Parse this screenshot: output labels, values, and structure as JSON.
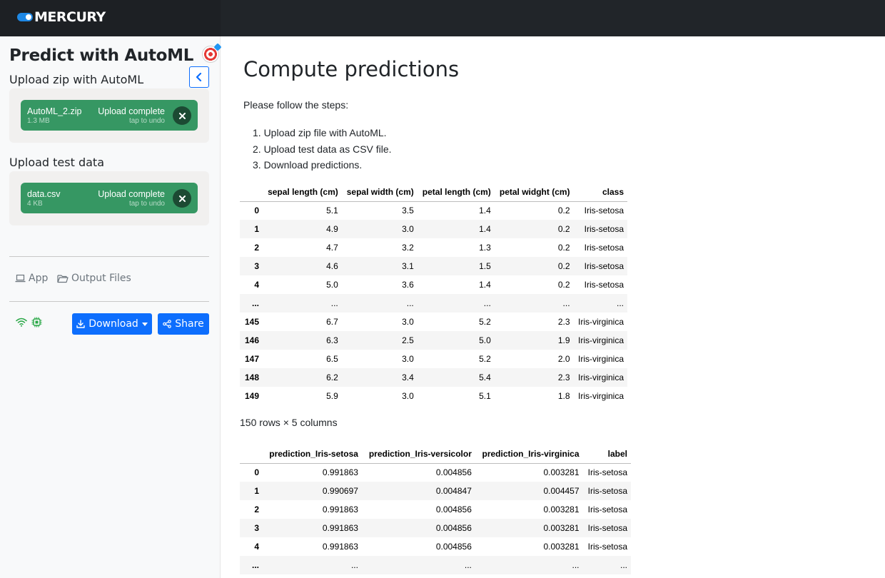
{
  "app": {
    "brand": "MERCURY"
  },
  "sidebar": {
    "title": "Predict with AutoML",
    "upload_zip": {
      "label": "Upload zip with AutoML",
      "file_name": "AutoML_2.zip",
      "file_size": "1.3 MB",
      "status": "Upload complete",
      "undo_hint": "tap to undo"
    },
    "upload_test": {
      "label": "Upload test data",
      "file_name": "data.csv",
      "file_size": "4 KB",
      "status": "Upload complete",
      "undo_hint": "tap to undo"
    },
    "links": {
      "app": "App",
      "output_files": "Output Files"
    },
    "buttons": {
      "download": "Download",
      "share": "Share"
    }
  },
  "main": {
    "title": "Compute predictions",
    "intro": "Please follow the steps:",
    "steps": [
      "1. Upload zip file with AutoML.",
      "2. Upload test data as CSV file.",
      "3. Download predictions."
    ],
    "table1": {
      "columns": [
        "",
        "sepal length (cm)",
        "sepal width (cm)",
        "petal length (cm)",
        "petal widght (cm)",
        "class"
      ],
      "rows": [
        [
          "0",
          "5.1",
          "3.5",
          "1.4",
          "0.2",
          "Iris-setosa"
        ],
        [
          "1",
          "4.9",
          "3.0",
          "1.4",
          "0.2",
          "Iris-setosa"
        ],
        [
          "2",
          "4.7",
          "3.2",
          "1.3",
          "0.2",
          "Iris-setosa"
        ],
        [
          "3",
          "4.6",
          "3.1",
          "1.5",
          "0.2",
          "Iris-setosa"
        ],
        [
          "4",
          "5.0",
          "3.6",
          "1.4",
          "0.2",
          "Iris-setosa"
        ],
        [
          "...",
          "...",
          "...",
          "...",
          "...",
          "..."
        ],
        [
          "145",
          "6.7",
          "3.0",
          "5.2",
          "2.3",
          "Iris-virginica"
        ],
        [
          "146",
          "6.3",
          "2.5",
          "5.0",
          "1.9",
          "Iris-virginica"
        ],
        [
          "147",
          "6.5",
          "3.0",
          "5.2",
          "2.0",
          "Iris-virginica"
        ],
        [
          "148",
          "6.2",
          "3.4",
          "5.4",
          "2.3",
          "Iris-virginica"
        ],
        [
          "149",
          "5.9",
          "3.0",
          "5.1",
          "1.8",
          "Iris-virginica"
        ]
      ],
      "shape": "150 rows × 5 columns"
    },
    "table2": {
      "columns": [
        "",
        "prediction_Iris-setosa",
        "prediction_Iris-versicolor",
        "prediction_Iris-virginica",
        "label"
      ],
      "rows": [
        [
          "0",
          "0.991863",
          "0.004856",
          "0.003281",
          "Iris-setosa"
        ],
        [
          "1",
          "0.990697",
          "0.004847",
          "0.004457",
          "Iris-setosa"
        ],
        [
          "2",
          "0.991863",
          "0.004856",
          "0.003281",
          "Iris-setosa"
        ],
        [
          "3",
          "0.991863",
          "0.004856",
          "0.003281",
          "Iris-setosa"
        ],
        [
          "4",
          "0.991863",
          "0.004856",
          "0.003281",
          "Iris-setosa"
        ],
        [
          "...",
          "...",
          "...",
          "...",
          "..."
        ]
      ]
    }
  },
  "colors": {
    "navbar": "#212529",
    "accent": "#0d6efd",
    "upload_success": "#369763",
    "status_ok": "#28a745"
  },
  "icons": {
    "title_emoji": "target-icon",
    "collapse": "chevron-left-icon",
    "remove_file": "close-icon",
    "app_link": "laptop-icon",
    "output_link": "folder-icon",
    "connection": "wifi-icon",
    "worker": "cpu-icon",
    "download": "download-icon",
    "share": "share-icon"
  }
}
